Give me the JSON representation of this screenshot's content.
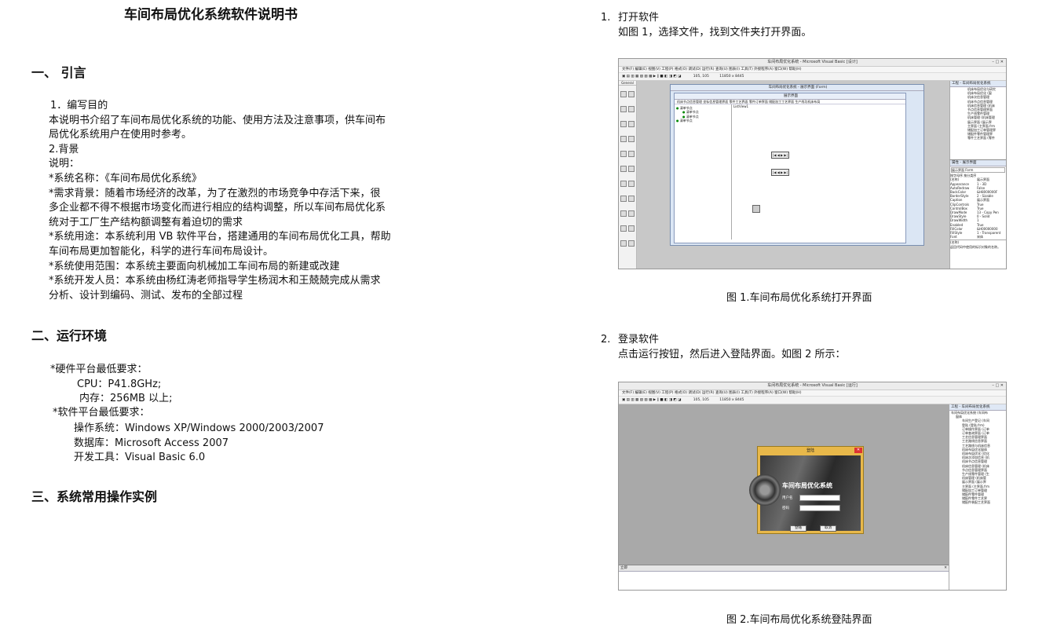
{
  "doc_title": "车间布局优化系统软件说明书",
  "sec1": {
    "heading": "一、 引言",
    "sub1": "1．编写目的",
    "sub1_text": [
      "本说明书介绍了车间布局优化系统的功能、使用方法及注意事项，供车间布",
      "局优化系统用户在使用时参考。"
    ],
    "sub2": "2.背景",
    "lines": [
      "说明：",
      "*系统名称：《车间布局优化系统》",
      "*需求背景：随着市场经济的改革，为了在激烈的市场竞争中存活下来，很",
      "多企业都不得不根据市场变化而进行相应的结构调整，所以车间布局优化系",
      "统对于工厂生产结构额调整有着迫切的需求",
      "*系统用途：本系统利用 VB 软件平台，搭建通用的车间布局优化工具，帮助",
      "车间布局更加智能化，科学的进行车间布局设计。",
      "*系统使用范围：本系统主要面向机械加工车间布局的新建或改建",
      "*系统开发人员：本系统由杨红涛老师指导学生杨润木和王兢兢完成从需求",
      "分析、设计到编码、测试、发布的全部过程"
    ]
  },
  "sec2": {
    "heading": "二、运行环境",
    "hw_title": "*硬件平台最低要求：",
    "cpu": "CPU：P41.8GHz;",
    "mem": "内存：256MB 以上;",
    "sw_title": "*软件平台最低要求：",
    "os": "操作系统：Windows  XP/Windows  2000/2003/2007",
    "db": "数据库：Microsoft  Access 2007",
    "tool": "开发工具：Visual Basic 6.0"
  },
  "sec3": {
    "heading": "三、系统常用操作实例"
  },
  "step1": {
    "num": "1.",
    "title": "打开软件",
    "desc": "如图 1，选择文件，找到文件夹打开界面。"
  },
  "step2": {
    "num": "2.",
    "title": "登录软件",
    "desc": "点击运行按钮，然后进入登陆界面。如图 2 所示："
  },
  "fig1": {
    "caption": "图 1.车间布局优化系统打开界面",
    "window_title": "车间布局优化系统 - Microsoft Visual Basic [设计]",
    "menu": "文件(F)  编辑(E)  视图(V)  工程(P)  格式(O)  调试(D)  运行(R)  查询(U)  图表(I)  工具(T)  外接程序(A)  窗口(W)  帮助(H)",
    "coords": "105, 105",
    "size": "11850 x 8445",
    "form_window_title": "车间布局优化系统 - 展示界面 (Form)",
    "form_caption": "展示界面",
    "form_menu": "机床节点信息管理    坐标信息管理界面    零件工艺界面    零件订单界面    储配加工工艺界面    生产线功机床布局",
    "tree_nodes": [
      "清单节点",
      "清单节点",
      "清单节点",
      "清单节点"
    ],
    "listview": "ListView1",
    "project_title": "工程 - 车间布局优化系统",
    "project_items": [
      "机床布局优化与研究",
      "机床布局优化 (窗",
      "机床次信息管理",
      "机床节点信息管理",
      "机床信息管理 (机床",
      "节点信息管理界面",
      "生产线零件管理",
      "机床管理 (机床管理",
      "展示界面 (展示界",
      "主界面 (主界面.frm",
      "储配加工订单管理界",
      "储配件零件管理界",
      "零件工艺界面 (零件"
    ],
    "props_title": "属性 - 展示界面",
    "props_obj": "展示界面 Form",
    "props_tabs": "按字母序   按分类序",
    "props": [
      [
        "(名称)",
        "展示界面"
      ],
      [
        "Appearance",
        "1 - 3D"
      ],
      [
        "AutoRedraw",
        "False"
      ],
      [
        "BackColor",
        "&H8000000F"
      ],
      [
        "BorderStyle",
        "2 - Sizable"
      ],
      [
        "Caption",
        "展示界面"
      ],
      [
        "ClipControls",
        "True"
      ],
      [
        "ControlBox",
        "True"
      ],
      [
        "DrawMode",
        "13 - Copy Pen"
      ],
      [
        "DrawStyle",
        "0 - Solid"
      ],
      [
        "DrawWidth",
        "1"
      ],
      [
        "Enabled",
        "True"
      ],
      [
        "FillColor",
        "&H00000000"
      ],
      [
        "FillStyle",
        "1 - Transparent"
      ],
      [
        "Font",
        "宋体"
      ]
    ],
    "props_desc": "(名称)",
    "props_desc2": "返回代码中使用的标识对象的名称。",
    "toolbox_title": "General"
  },
  "fig2": {
    "caption": "图 2.车间布局优化系统登陆界面",
    "window_title": "车间布局优化系统 - Microsoft Visual Basic [运行]",
    "menu": "文件(F)  编辑(E)  视图(V)  工程(P)  格式(O)  调试(D)  运行(R)  查询(U)  图表(I)  工具(T)  外接程序(A)  窗口(W)  帮助(H)",
    "coords": "105, 105",
    "size": "11850 x 8445",
    "login_title": "登陆",
    "login_heading": "车间布局优化系统",
    "user_label": "用户名",
    "pwd_label": "密码",
    "btn_login": "登陆",
    "btn_cancel": "取消",
    "project_title": "工程 - 车间布局优化系统",
    "project_root": "车间布局优化系统 (车间布",
    "project_folder": "窗体",
    "project_items": [
      "车间生产登记 (车间",
      "登陆 (登陆.frm)",
      "订单操作界面 (订单",
      "订单查询界面 (订单",
      "工艺信息管理界面",
      "工艺路线信息界面",
      "工艺路线与机床信息",
      "机床布局优化窗体",
      "机床布局优化 (优化",
      "机床次添加信息 (机",
      "机床节点信息管理",
      "机床信息管理 (机床",
      "节点信息管理界面",
      "生产线零件管理 (生",
      "机床管理 (机床管",
      "展示界面 (展示界",
      "主界面 (主界面.frm",
      "储配加工订单管理",
      "储配件零件管理",
      "储配件零件工艺界",
      "储配件装配工艺界面"
    ],
    "immediate": "立即"
  }
}
